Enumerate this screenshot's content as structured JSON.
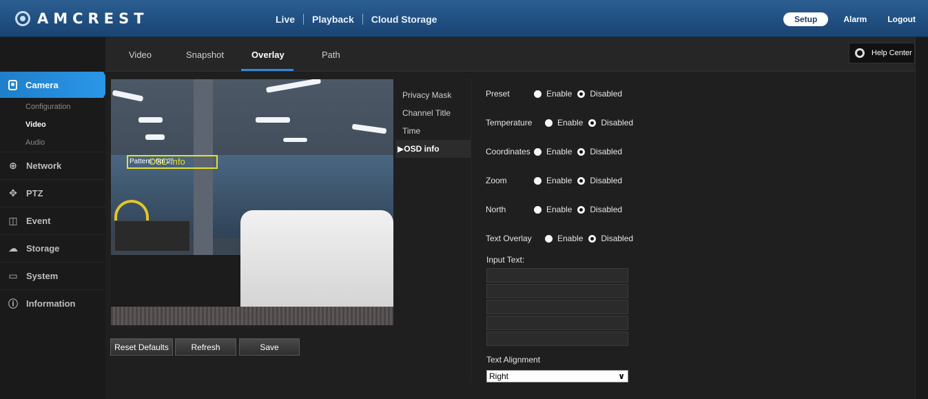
{
  "app": {
    "brand": "AMCREST",
    "main_nav": [
      "Live",
      "Playback",
      "Cloud Storage"
    ],
    "right_nav": {
      "setup": "Setup",
      "alarm": "Alarm",
      "logout": "Logout"
    },
    "help_center": "Help Center"
  },
  "subnav": {
    "tabs": [
      "Video",
      "Snapshot",
      "Overlay",
      "Path"
    ],
    "active": "Overlay"
  },
  "sidebar": {
    "camera": "Camera",
    "camera_sub": [
      "Configuration",
      "Video",
      "Audio"
    ],
    "active_sub": "Video",
    "items": [
      "Network",
      "PTZ",
      "Event",
      "Storage",
      "System",
      "Information"
    ]
  },
  "preview": {
    "osd_text": "OSD info",
    "osd_overlap_text": "Pattern: 0m 2°"
  },
  "buttons": {
    "reset": "Reset Defaults",
    "refresh": "Refresh",
    "save": "Save"
  },
  "overlay_menu": {
    "items": [
      "Privacy Mask",
      "Channel Title",
      "Time",
      "OSD info"
    ],
    "active": "OSD info",
    "active_marker": "▶"
  },
  "settings": {
    "enable_label": "Enable",
    "disabled_label": "Disabled",
    "rows": [
      {
        "label": "Preset",
        "value": "Disabled"
      },
      {
        "label": "Temperature",
        "value": "Disabled"
      },
      {
        "label": "Coordinates",
        "value": "Disabled"
      },
      {
        "label": "Zoom",
        "value": "Disabled"
      },
      {
        "label": "North",
        "value": "Disabled"
      },
      {
        "label": "Text Overlay",
        "value": "Disabled"
      }
    ],
    "input_text_label": "Input Text:",
    "input_lines": [
      "",
      "",
      "",
      "",
      ""
    ],
    "text_alignment_label": "Text Alignment",
    "text_alignment_value": "Right"
  },
  "colors": {
    "accent": "#2a96e8",
    "osd": "#e8e030",
    "topbar": "#1f4e7f"
  }
}
